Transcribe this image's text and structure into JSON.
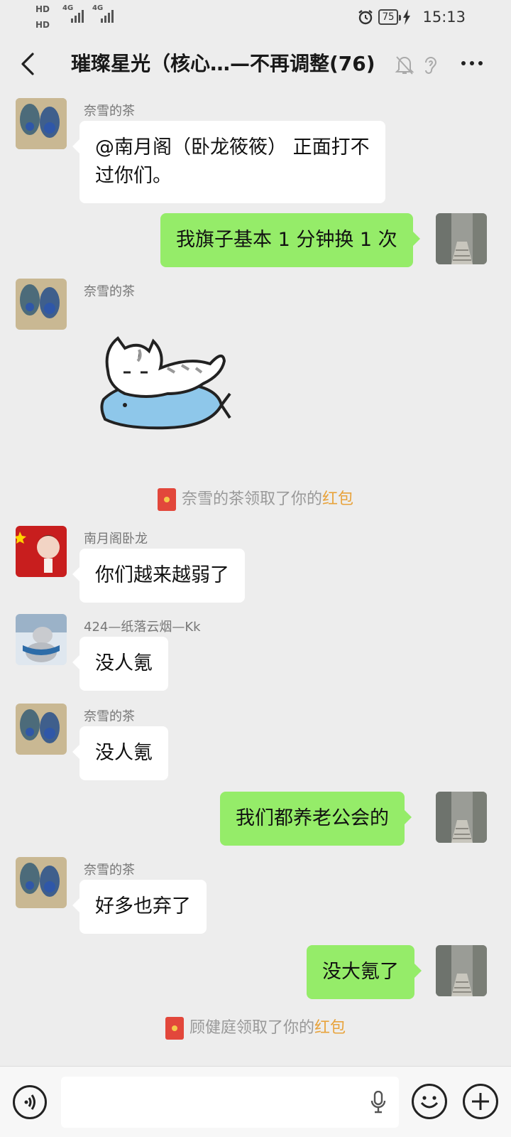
{
  "status_bar": {
    "hd1": "HD",
    "hd2": "HD",
    "net1": "4G",
    "net2": "4G",
    "battery": "75",
    "time": "15:13"
  },
  "header": {
    "title": "璀璨星光（核心…—不再调整(76)"
  },
  "messages": [
    {
      "side": "left",
      "sender": "奈雪的茶",
      "text": "@南月阁（卧龙筱筱） 正面打不\n过你们。"
    },
    {
      "side": "right",
      "text": "我旗子基本 1 分钟换 1 次"
    },
    {
      "side": "left",
      "sender": "奈雪的茶",
      "type": "sticker",
      "sticker": "cat-on-fish-sticker"
    },
    {
      "type": "system",
      "prefix": "奈雪的茶领取了你的",
      "highlight": "红包"
    },
    {
      "side": "left",
      "sender": "南月阁卧龙",
      "text": "你们越来越弱了"
    },
    {
      "side": "left",
      "sender": "424—纸落云烟—Kk",
      "text": "没人氪"
    },
    {
      "side": "left",
      "sender": "奈雪的茶",
      "text": "没人氪"
    },
    {
      "side": "right",
      "text": "我们都养老公会的"
    },
    {
      "side": "left",
      "sender": "奈雪的茶",
      "text": "好多也弃了"
    },
    {
      "side": "right",
      "text": "没大氪了"
    },
    {
      "type": "system",
      "prefix": "顾健庭领取了你的",
      "highlight": "红包"
    }
  ],
  "colors": {
    "background": "#ededed",
    "own_bubble": "#95ec69",
    "other_bubble": "#ffffff",
    "redpacket_link": "#e8a33c"
  }
}
